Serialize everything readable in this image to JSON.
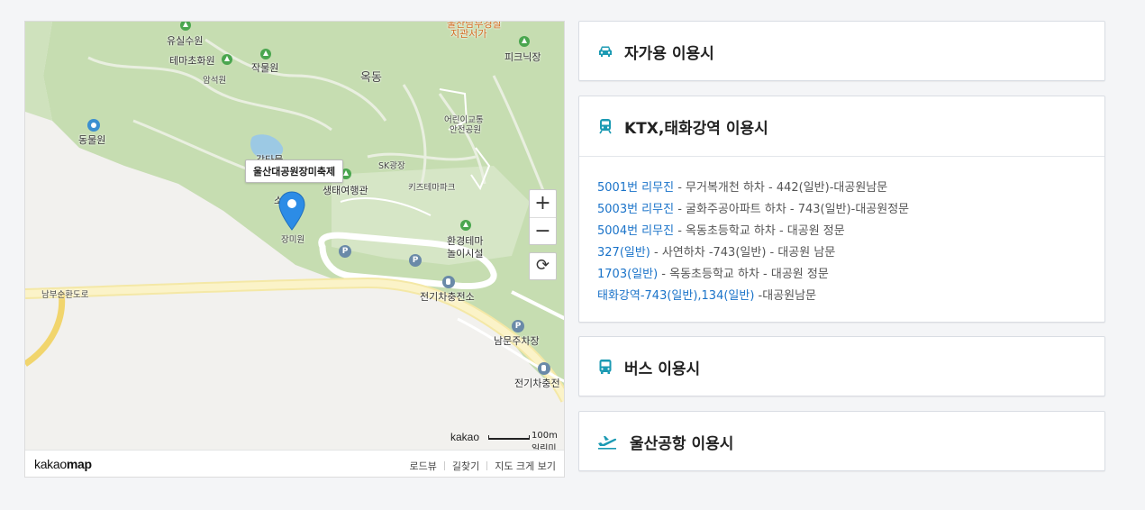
{
  "map": {
    "tooltip": "울산대공원장미축제",
    "labels": {
      "yusil": "유실수원",
      "tema_flower": "테마초화원",
      "amseok": "암석원",
      "jakmul": "작물원",
      "okdong": "옥동",
      "ulsan_top1": "울산남부경찰",
      "jigwanseoga": "지관서가",
      "picnic": "피크닉장",
      "zoo": "동물원",
      "gamtae": "감타물",
      "children_traffic_1": "어린이교통",
      "children_traffic_2": "안전공원",
      "sk_plaza": "SK광장",
      "ecotour": "생태여행관",
      "kids_theme": "키즈테마파크",
      "rose_garden": "장미원",
      "so": "소",
      "env_theme_1": "환경테마",
      "env_theme_2": "놀이시설",
      "nambu_road": "남부순환도로",
      "ev_charge_1": "전기차충전소",
      "south_parking": "남문주차장",
      "ev_charge_2": "전기차충전"
    },
    "zoom_in": "+",
    "zoom_out": "−",
    "reset": "⟳",
    "scale_brand": "kakao",
    "scale_text": "100m",
    "scale_suffix": "일린미",
    "footer_logo_light": "kakao",
    "footer_logo_bold": "map",
    "footer_links": [
      "로드뷰",
      "길찾기",
      "지도 크게 보기"
    ]
  },
  "panels": [
    {
      "icon": "car-icon",
      "title": "자가용 이용시"
    },
    {
      "icon": "train-icon",
      "title": "KTX,태화강역 이용시",
      "routes": [
        {
          "hl": "5001번 리무진",
          "rest": " - 무거복개천 하차 - 442(일반)-대공원남문"
        },
        {
          "hl": "5003번 리무진",
          "rest": " - 굴화주공아파트 하차 - 743(일반)-대공원정문"
        },
        {
          "hl": "5004번 리무진",
          "rest": " - 옥동초등학교 하차 - 대공원 정문"
        },
        {
          "hl": "327(일반)",
          "rest": " - 사연하차 -743(일반) - 대공원 남문"
        },
        {
          "hl": "1703(일반)",
          "rest": " - 옥동초등학교 하차 - 대공원 정문"
        },
        {
          "hl": "태화강역-743(일반),134(일반)",
          "rest": " -대공원남문"
        }
      ]
    },
    {
      "icon": "bus-icon",
      "title": "버스 이용시"
    },
    {
      "icon": "airplane-icon",
      "title": "울산공항 이용시"
    }
  ],
  "colors": {
    "accent": "#1b9ab3",
    "link": "#1a73c9",
    "park": "#c5dcb0",
    "road": "#f5eec4"
  }
}
